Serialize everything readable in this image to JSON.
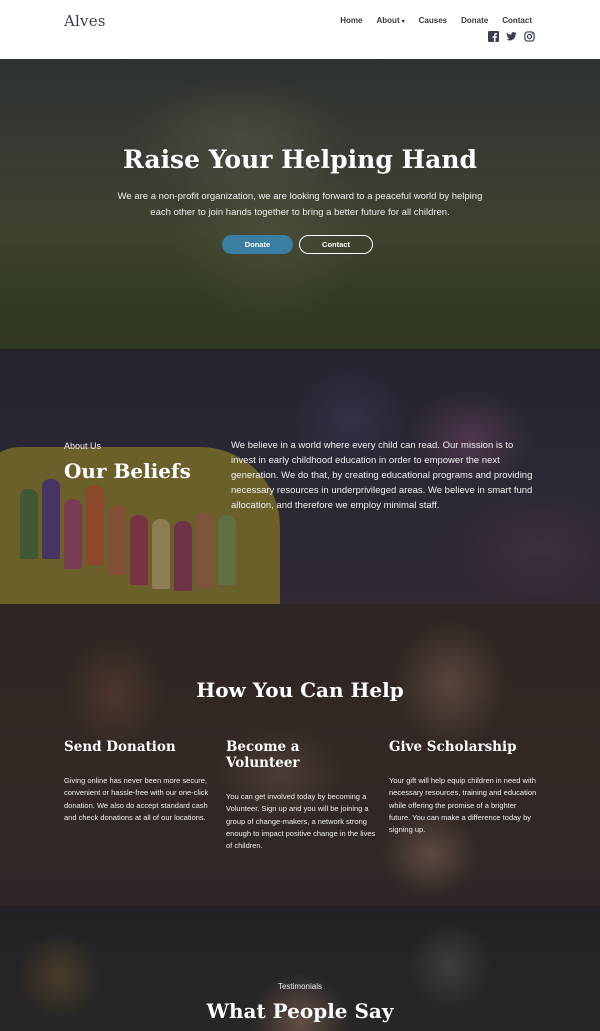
{
  "header": {
    "logo": "Alves",
    "nav": [
      {
        "label": "Home"
      },
      {
        "label": "About"
      },
      {
        "label": "Causes"
      },
      {
        "label": "Donate"
      },
      {
        "label": "Contact"
      }
    ],
    "about_caret": "▾",
    "social": [
      "facebook-icon",
      "twitter-icon",
      "instagram-icon"
    ]
  },
  "hero": {
    "title": "Raise Your Helping Hand",
    "text": "We are a non-profit organization, we are looking forward to a peaceful world by helping each other to join hands together to bring a better future for all children.",
    "donate_label": "Donate",
    "contact_label": "Contact",
    "accent": "#3a7ea2"
  },
  "about": {
    "eyebrow": "About Us",
    "title": "Our Beliefs",
    "text": "We believe in a world where every child can read. Our mission is to invest in early childhood education in order to empower the next generation. We do that, by creating educational programs and providing necessary resources in underprivileged areas. We believe in smart fund allocation, and therefore we employ minimal staff."
  },
  "help": {
    "title": "How You Can Help",
    "columns": [
      {
        "title": "Send Donation",
        "text": "Giving online has never been more secure, convenient or hassle-free with our one-click donation. We also do accept standard cash and check donations at all of our locations."
      },
      {
        "title": "Become a Volunteer",
        "text": "You can get involved today by becoming a Volunteer. Sign up and you will be joining a group of change-makers, a network strong enough to impact positive change in the lives of children."
      },
      {
        "title": "Give Scholarship",
        "text": "Your gift will help equip children in need with necessary resources, training and education while offering the promise of a brighter future. You can make a difference today by signing up."
      }
    ]
  },
  "testimonials": {
    "eyebrow": "Testimonials",
    "title": "What People Say"
  }
}
